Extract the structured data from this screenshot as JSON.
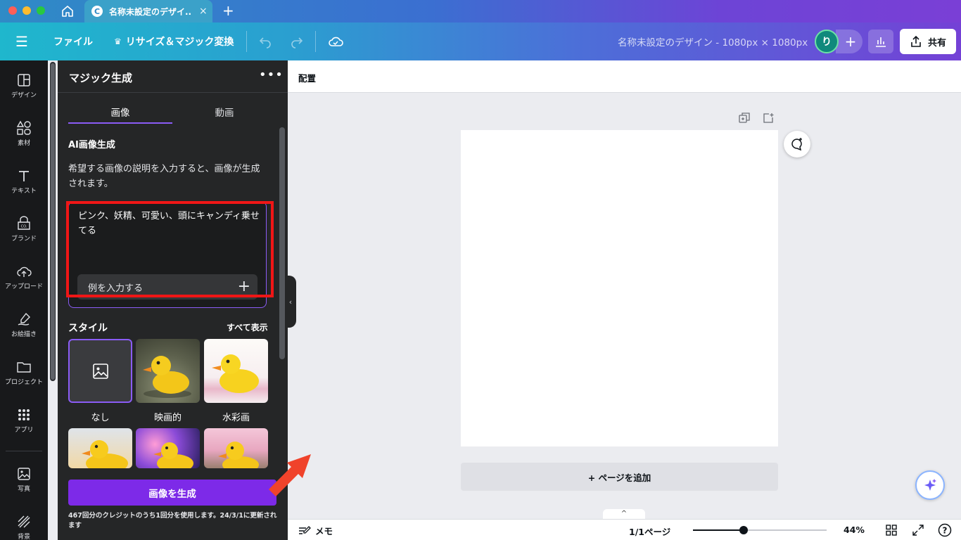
{
  "window": {
    "tab_logo": "C",
    "tab_title": "名称未設定のデザイ...",
    "tab_close": "×",
    "new_tab": "+"
  },
  "toolbar": {
    "file": "ファイル",
    "resize": "リサイズ＆マジック変換",
    "doc_title": "名称未設定のデザイン - 1080px × 1080px",
    "avatar_initial": "り",
    "add_member": "+",
    "share": "共有"
  },
  "rail": {
    "items": [
      {
        "label": "デザイン",
        "icon": "layout-icon"
      },
      {
        "label": "素材",
        "icon": "shapes-icon"
      },
      {
        "label": "テキスト",
        "icon": "text-icon"
      },
      {
        "label": "ブランド",
        "icon": "brand-icon"
      },
      {
        "label": "アップロード",
        "icon": "upload-icon"
      },
      {
        "label": "お絵描き",
        "icon": "draw-icon"
      },
      {
        "label": "プロジェクト",
        "icon": "folder-icon"
      },
      {
        "label": "アプリ",
        "icon": "apps-icon"
      },
      {
        "label": "写真",
        "icon": "photo-icon"
      },
      {
        "label": "背景",
        "icon": "background-icon"
      }
    ]
  },
  "panel": {
    "title": "マジック生成",
    "more": "•••",
    "tabs": [
      "画像",
      "動画"
    ],
    "section_title": "AI画像生成",
    "description": "希望する画像の説明を入力すると、画像が生成されます。",
    "prompt_value": "ピンク、妖精、可愛い、頭にキャンディ乗せてる",
    "example_button": "例を入力する",
    "example_plus": "+",
    "style_title": "スタイル",
    "style_all": "すべて表示",
    "styles": [
      "なし",
      "映画的",
      "水彩画"
    ],
    "generate_button": "画像を生成",
    "credits": "467回分のクレジットのうち1回分を使用します。24/3/1に更新されます"
  },
  "canvas": {
    "context_label": "配置",
    "add_page": "+ ページを追加"
  },
  "bottombar": {
    "expand": "^",
    "notes": "メモ",
    "page_count": "1/1ページ",
    "zoom": "44%",
    "zoom_level": 0.44,
    "help": "?"
  },
  "colors": {
    "accent": "#7d2ae8",
    "highlight": "#f01616",
    "panel_bg": "#252627",
    "rail_bg": "#18191b"
  }
}
